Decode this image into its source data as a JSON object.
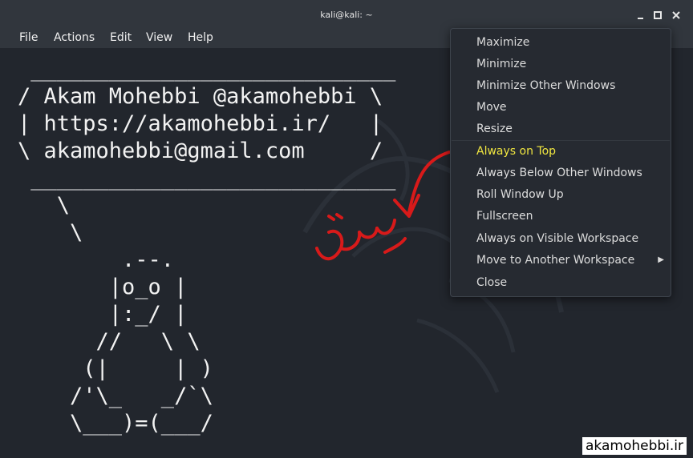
{
  "window": {
    "title": "kali@kali: ~"
  },
  "menubar": [
    "File",
    "Actions",
    "Edit",
    "View",
    "Help"
  ],
  "terminal": {
    "ascii_art": " ____________________________\n/ Akam Mohebbi @akamohebbi \\\n| https://akamohebbi.ir/   |\n\\ akamohebbi@gmail.com     /\n ____________________________\n   \\\n    \\\n        .--.\n       |o_o |\n       |:_/ |\n      //   \\ \\\n     (|     | )\n    /'\\_   _/`\\\n    \\___)=(___/"
  },
  "context_menu": {
    "items": [
      {
        "label": "Maximize",
        "has_submenu": false
      },
      {
        "label": "Minimize",
        "has_submenu": false
      },
      {
        "label": "Minimize Other Windows",
        "has_submenu": false
      },
      {
        "label": "Move",
        "has_submenu": false
      },
      {
        "label": "Resize",
        "has_submenu": false
      },
      {
        "label": "Always on Top",
        "has_submenu": false,
        "highlighted": true
      },
      {
        "label": "Always Below Other Windows",
        "has_submenu": false
      },
      {
        "label": "Roll Window Up",
        "has_submenu": false
      },
      {
        "label": "Fullscreen",
        "has_submenu": false
      },
      {
        "label": "Always on Visible Workspace",
        "has_submenu": false
      },
      {
        "label": "Move to Another Workspace",
        "has_submenu": true
      },
      {
        "label": "Close",
        "has_submenu": false
      }
    ],
    "highlight_color": "#f0e640"
  },
  "annotation": {
    "color": "#d81a1a"
  },
  "watermark": "akamohebbi.ir",
  "icons": {
    "minimize": "minimize-icon",
    "maximize": "maximize-icon",
    "close": "close-icon",
    "submenu": "chevron-right-icon"
  }
}
